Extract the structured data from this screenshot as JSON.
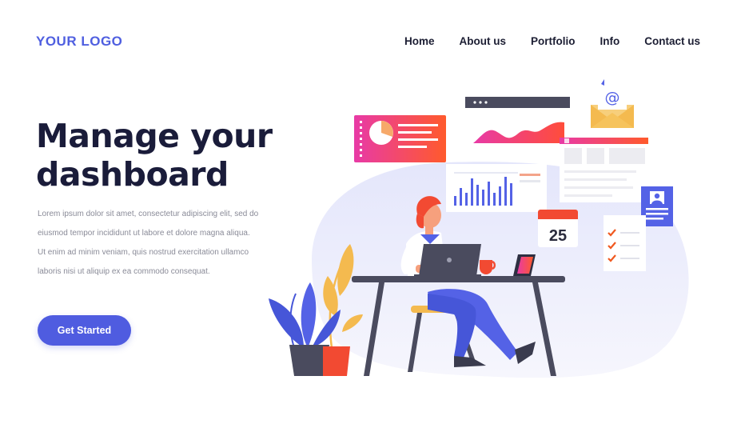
{
  "header": {
    "logo_text": "YOUR LOGO",
    "nav": [
      {
        "label": "Home"
      },
      {
        "label": "About us"
      },
      {
        "label": "Portfolio"
      },
      {
        "label": "Info"
      },
      {
        "label": "Contact us"
      }
    ]
  },
  "hero": {
    "headline_line1": "Manage your",
    "headline_line2": "dashboard",
    "body_lines": [
      "Lorem ipsum dolor sit amet, consectetur adipiscing elit, sed do",
      "eiusmod tempor incididunt ut labore et dolore magna aliqua.",
      "Ut enim ad minim veniam, quis nostrud exercitation ullamco",
      "laboris nisi ut aliquip ex ea commodo consequat."
    ],
    "cta_label": "Get Started"
  },
  "illustration": {
    "calendar_day": "25",
    "email_symbol": "@"
  },
  "colors": {
    "brand": "#4f5ce0",
    "heading": "#1a1c3a",
    "accent_orange": "#ff5a2c",
    "accent_pink": "#e83aa6"
  }
}
